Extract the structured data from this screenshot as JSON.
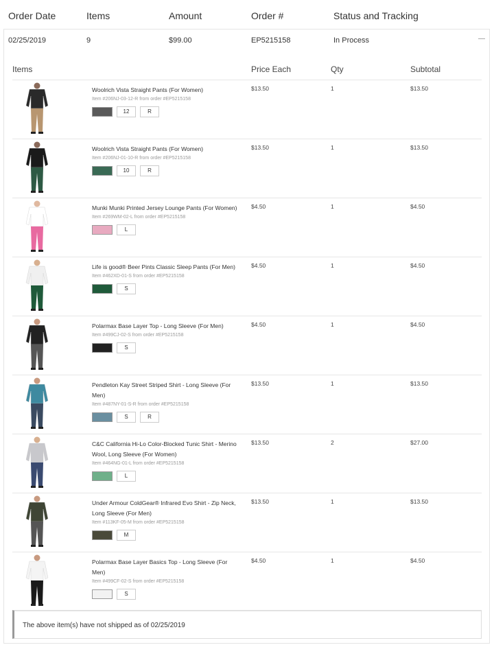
{
  "header": {
    "order_date": "Order Date",
    "items": "Items",
    "amount": "Amount",
    "order_no": "Order #",
    "status": "Status and Tracking"
  },
  "order": {
    "date": "02/25/2019",
    "items": "9",
    "amount": "$99.00",
    "number": "EP5215158",
    "status": "In Process"
  },
  "table_headers": {
    "items": "Items",
    "price": "Price Each",
    "qty": "Qty",
    "subtotal": "Subtotal"
  },
  "rows": [
    {
      "title": "Woolrich Vista Straight Pants (For Women)",
      "sku": "Item #206NJ-03-12-R from order #EP5215158",
      "options": [
        "12",
        "R"
      ],
      "swatch": "#5a5a5a",
      "price": "$13.50",
      "qty": "1",
      "subtotal": "$13.50",
      "icon": "tan-pants-thumbnail",
      "colors": {
        "top": "#2a2a2a",
        "bottom": "#b89670",
        "skin": "#8a6a5a"
      }
    },
    {
      "title": "Woolrich Vista Straight Pants (For Women)",
      "sku": "Item #206NJ-01-10-R from order #EP5215158",
      "options": [
        "10",
        "R"
      ],
      "swatch": "#3a6a55",
      "price": "$13.50",
      "qty": "1",
      "subtotal": "$13.50",
      "icon": "green-pants-thumbnail",
      "colors": {
        "top": "#1a1a1a",
        "bottom": "#2e5a44",
        "skin": "#8a6a5a"
      }
    },
    {
      "title": "Munki Munki Printed Jersey Lounge Pants (For Women)",
      "sku": "Item #269WM-02-L from order #EP5215158",
      "options": [
        "L"
      ],
      "swatch": "#e8aac0",
      "price": "$4.50",
      "qty": "1",
      "subtotal": "$4.50",
      "icon": "pink-lounge-pants-thumbnail",
      "colors": {
        "top": "#ffffff",
        "bottom": "#e86aa0",
        "skin": "#e0b9a0"
      }
    },
    {
      "title": "Life is good® Beer Pints Classic Sleep Pants (For Men)",
      "sku": "Item #462XD-01-S from order #EP5215158",
      "options": [
        "S"
      ],
      "swatch": "#1f5a3a",
      "price": "$4.50",
      "qty": "1",
      "subtotal": "$4.50",
      "icon": "green-sleep-pants-thumbnail",
      "colors": {
        "top": "#f0f0f0",
        "bottom": "#1f5a3a",
        "skin": "#d8b090"
      }
    },
    {
      "title": "Polarmax Base Layer Top - Long Sleeve (For Men)",
      "sku": "Item #499CJ-02-S from order #EP5215158",
      "options": [
        "S"
      ],
      "swatch": "#222222",
      "price": "$4.50",
      "qty": "1",
      "subtotal": "$4.50",
      "icon": "black-top-thumbnail",
      "colors": {
        "top": "#222222",
        "bottom": "#555555",
        "skin": "#c89a80"
      }
    },
    {
      "title": "Pendleton Kay Street Striped Shirt - Long Sleeve (For Men)",
      "sku": "Item #487NY-01-S-R from order #EP5215158",
      "options": [
        "S",
        "R"
      ],
      "swatch": "#6a8fa0",
      "price": "$13.50",
      "qty": "1",
      "subtotal": "$13.50",
      "icon": "blue-striped-shirt-thumbnail",
      "colors": {
        "top": "#3f8aa0",
        "bottom": "#3a4a60",
        "skin": "#c89a80"
      }
    },
    {
      "title": "C&C California Hi-Lo Color-Blocked Tunic Shirt - Merino Wool, Long Sleeve (For Women)",
      "sku": "Item #464NG-01-L from order #EP5215158",
      "options": [
        "L"
      ],
      "swatch": "#6fb08a",
      "price": "$13.50",
      "qty": "2",
      "subtotal": "$27.00",
      "icon": "grey-tunic-thumbnail",
      "colors": {
        "top": "#c8c8cc",
        "bottom": "#3a4a70",
        "skin": "#d8b090"
      }
    },
    {
      "title": "Under Armour ColdGear® Infrared Evo Shirt - Zip Neck, Long Sleeve (For Men)",
      "sku": "Item #113KF-05-M from order #EP5215158",
      "options": [
        "M"
      ],
      "swatch": "#4a4a3a",
      "price": "$13.50",
      "qty": "1",
      "subtotal": "$13.50",
      "icon": "olive-zip-shirt-thumbnail",
      "colors": {
        "top": "#3f4535",
        "bottom": "#555555",
        "skin": "#c89a80"
      }
    },
    {
      "title": "Polarmax Base Layer Basics Top - Long Sleeve (For Men)",
      "sku": "Item #499CF-02-S from order #EP5215158",
      "options": [
        "S"
      ],
      "swatch": "#f2f2f2",
      "price": "$4.50",
      "qty": "1",
      "subtotal": "$4.50",
      "icon": "white-top-thumbnail",
      "colors": {
        "top": "#f4f4f4",
        "bottom": "#1a1a1a",
        "skin": "#c89a80"
      }
    }
  ],
  "notice": "The above item(s) have not shipped as of 02/25/2019"
}
